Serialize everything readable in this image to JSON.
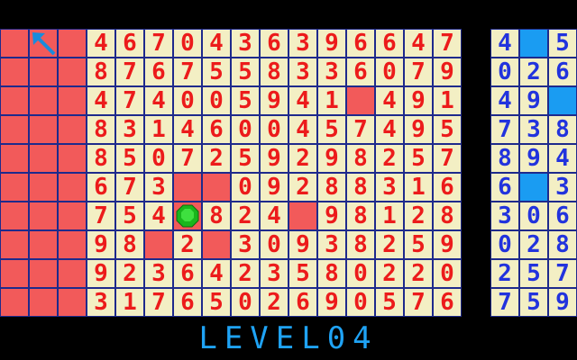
{
  "board": {
    "rows": [
      "___4670436396647",
      "___8767558336079",
      "___474005941_491",
      "___8314600457495",
      "___8507259298257",
      "___673__09288316",
      "___754_824_98128",
      "___98_2_30938259",
      "___9236423580220",
      "___3176502690576"
    ]
  },
  "side_panel": {
    "rows": [
      "4_5",
      "026",
      "49_",
      "738",
      "894",
      "6_3",
      "306",
      "028",
      "257",
      "759"
    ]
  },
  "player": {
    "row": 6,
    "col": 6
  },
  "cursor": {
    "row": 0,
    "col": 1
  },
  "level": {
    "label": "LEVEL",
    "number": "04"
  },
  "colors": {
    "tile_bg": "#f3efc4",
    "board_digit": "#ec1b1b",
    "empty_tile": "#f25a5a",
    "grid": "#1e2a8c",
    "side_digit": "#2233dd",
    "side_empty": "#1a9cf2",
    "level_text": "#1fa3f5",
    "player": "#19b61c",
    "cursor": "#1a8bdc"
  },
  "icons": {
    "player": "green-octagon-player-icon",
    "cursor": "diagonal-arrow-cursor-icon"
  }
}
